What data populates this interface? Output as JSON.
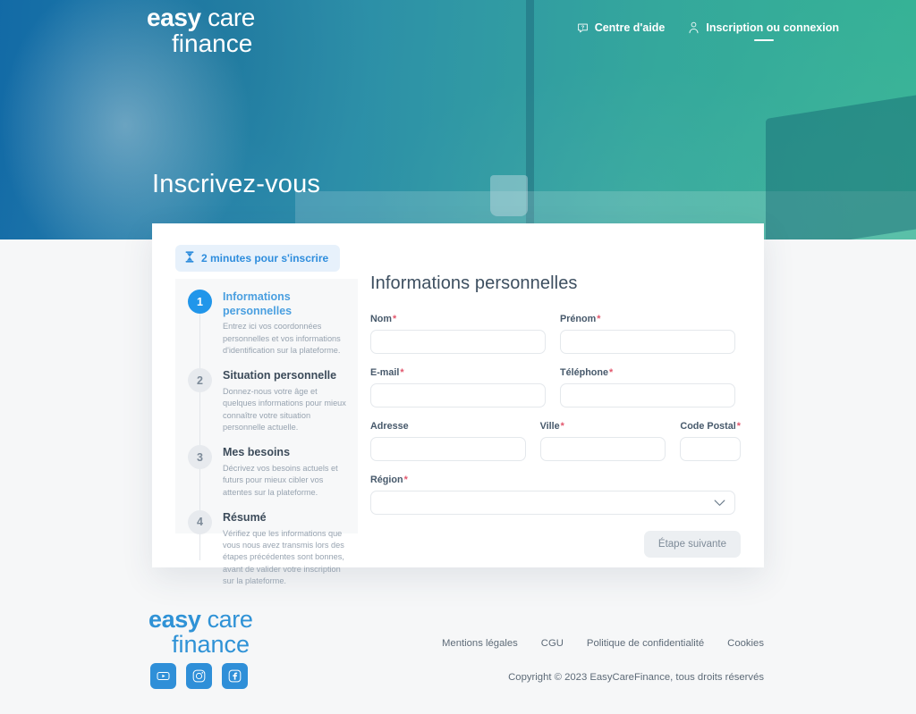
{
  "brand": {
    "word_bold": "easy",
    "word_light": "care",
    "word_line2": "finance"
  },
  "header": {
    "nav": [
      {
        "label": "Centre d'aide",
        "icon": "help-bubble-icon",
        "active": false
      },
      {
        "label": "Inscription ou connexion",
        "icon": "user-icon",
        "active": true
      }
    ]
  },
  "hero": {
    "title": "Inscrivez-vous"
  },
  "card": {
    "badge": {
      "icon": "hourglass-icon",
      "label": "2 minutes pour s'inscrire"
    },
    "steps": [
      {
        "number": "1",
        "title": "Informations personnelles",
        "desc": "Entrez ici vos coordonnées personnelles et vos informations d'identification sur la plateforme."
      },
      {
        "number": "2",
        "title": "Situation personnelle",
        "desc": "Donnez-nous votre âge et quelques informations pour mieux connaître votre situation personnelle actuelle."
      },
      {
        "number": "3",
        "title": "Mes besoins",
        "desc": "Décrivez vos besoins actuels et futurs pour mieux cibler vos attentes sur la plateforme."
      },
      {
        "number": "4",
        "title": "Résumé",
        "desc": "Vérifiez que les informations que vous nous avez transmis lors des étapes précédentes sont bonnes, avant de valider votre inscription sur la plateforme."
      }
    ],
    "form": {
      "title": "Informations personnelles",
      "fields": {
        "nom": {
          "label": "Nom",
          "required": "*",
          "value": "",
          "placeholder": ""
        },
        "prenom": {
          "label": "Prénom",
          "required": "*",
          "value": "",
          "placeholder": ""
        },
        "email": {
          "label": "E-mail",
          "required": "*",
          "value": "",
          "placeholder": ""
        },
        "telephone": {
          "label": "Téléphone",
          "required": "*",
          "value": "",
          "placeholder": ""
        },
        "adresse": {
          "label": "Adresse",
          "required": "",
          "value": "",
          "placeholder": ""
        },
        "ville": {
          "label": "Ville",
          "required": "*",
          "value": "",
          "placeholder": ""
        },
        "code_postal": {
          "label": "Code Postal",
          "required": "*",
          "value": "",
          "placeholder": ""
        },
        "region": {
          "label": "Région",
          "required": "*",
          "value": "",
          "placeholder": ""
        }
      },
      "next_button": "Étape suivante"
    }
  },
  "footer": {
    "socials": [
      {
        "name": "youtube-icon"
      },
      {
        "name": "instagram-icon"
      },
      {
        "name": "facebook-icon"
      }
    ],
    "links": [
      "Mentions légales",
      "CGU",
      "Politique de confidentialité",
      "Cookies"
    ],
    "copyright": "Copyright ©  2023 EasyCareFinance, tous droits réservés"
  },
  "colors": {
    "accent_blue": "#2196ea",
    "brand_blue": "#2f8fd8",
    "required_red": "#e2566c",
    "hero_left": "#136ca8",
    "hero_right": "#34b496",
    "page_bg": "#f6f7f8"
  }
}
